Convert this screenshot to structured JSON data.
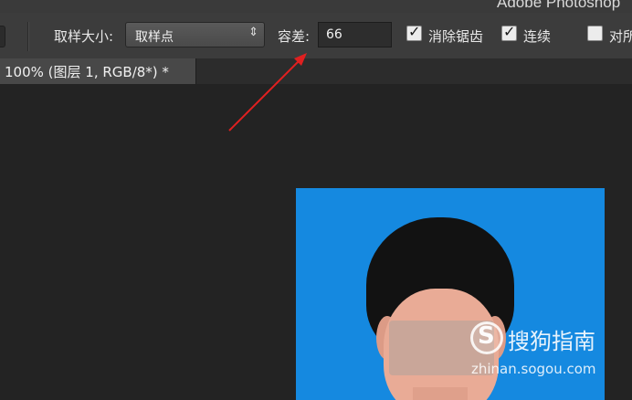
{
  "app": {
    "title": "Adobe Photoshop"
  },
  "options_bar": {
    "sample_size_label": "取样大小:",
    "sample_size_value": "取样点",
    "tolerance_label": "容差:",
    "tolerance_value": "66",
    "anti_alias_label": "消除锯齿",
    "anti_alias_checked": true,
    "contiguous_label": "连续",
    "contiguous_checked": true,
    "sample_all_label": "对所",
    "sample_all_checked": false
  },
  "document": {
    "tab_title": "100% (图层 1, RGB/8*) *"
  },
  "watermark": {
    "brand": "搜狗指南",
    "url": "zhinan.sogou.com",
    "logo_letter": "S"
  },
  "annotation": {
    "arrow_color": "#e02020"
  }
}
